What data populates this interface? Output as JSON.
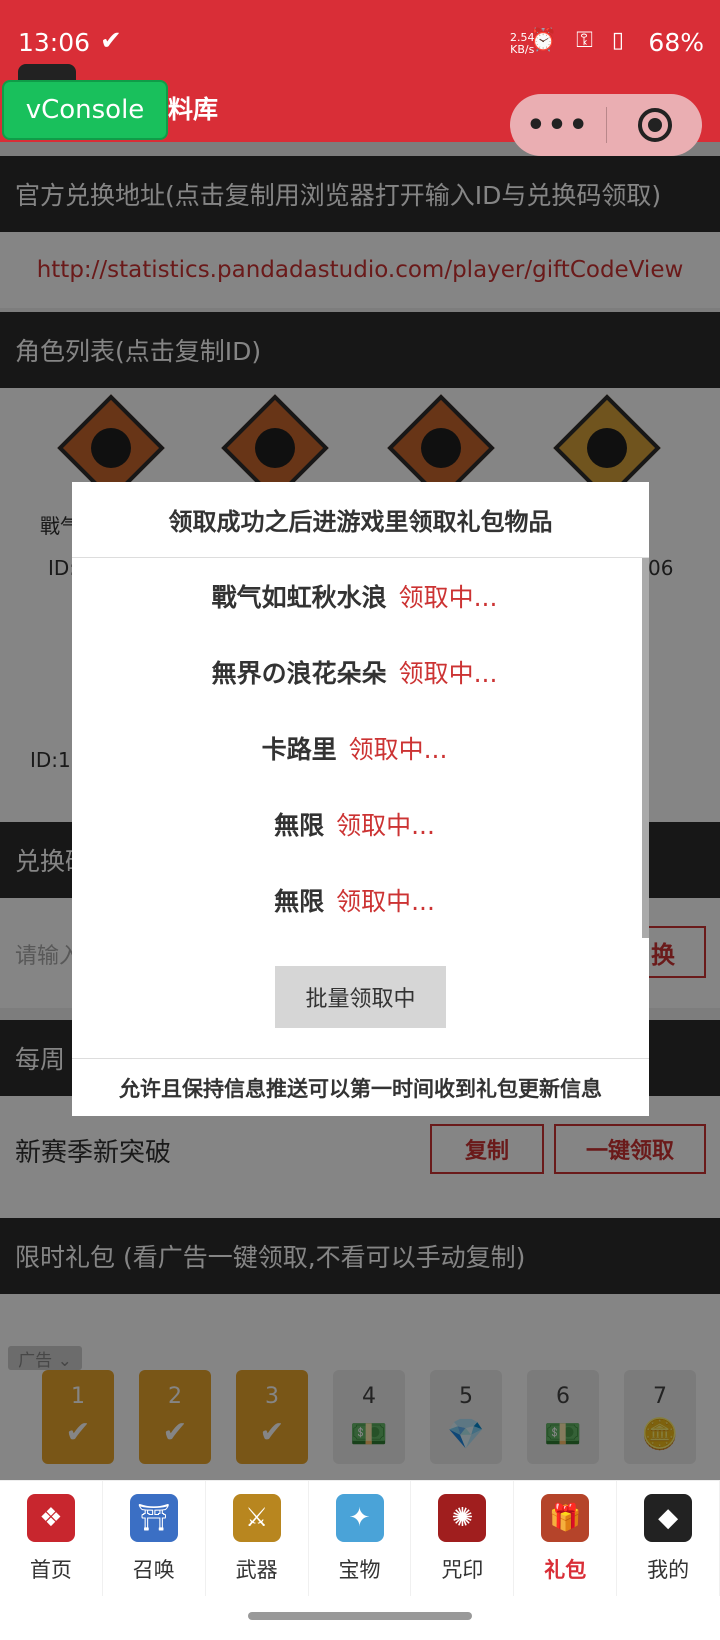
{
  "status_bar": {
    "time": "13:06",
    "battery": "68%",
    "speed_top": "2.54",
    "speed_unit": "KB/s"
  },
  "nav": {
    "title_suffix": "料库"
  },
  "vconsole_label": "vConsole",
  "capsule": {
    "more": "•••"
  },
  "sections": {
    "official": "官方兑换地址(点击复制用浏览器打开输入ID与兑换码领取)",
    "link": "http://statistics.pandadastudio.com/player/giftCodeView",
    "roles": "角色列表(点击复制ID)",
    "exchange_partial": "兑换码",
    "weekly_partial": "每周",
    "limited": "限时礼包 (看广告一键领取,不看可以手动复制)"
  },
  "roles": {
    "name_partial": "戰气",
    "id_partial_1": "ID:",
    "id_right": "06",
    "id_partial_2": "ID:10"
  },
  "exchange": {
    "placeholder_partial": "请输入",
    "button_partial": "换"
  },
  "weekly": {
    "text": "新赛季新突破",
    "copy_label": "复制",
    "claim_label": "一键领取"
  },
  "ad": {
    "tag": "广告 ⌄"
  },
  "days": [
    {
      "num": "1",
      "mark": "✔",
      "done": true
    },
    {
      "num": "2",
      "mark": "✔",
      "done": true
    },
    {
      "num": "3",
      "mark": "✔",
      "done": true
    },
    {
      "num": "4",
      "icon": "cash-icon",
      "done": false
    },
    {
      "num": "5",
      "icon": "gem-icon",
      "done": false
    },
    {
      "num": "6",
      "icon": "cash-icon",
      "done": false
    },
    {
      "num": "7",
      "icon": "coins-icon",
      "done": false
    }
  ],
  "modal": {
    "title": "领取成功之后进游戏里领取礼包物品",
    "items": [
      {
        "name": "戰气如虹秋水浪",
        "status": "领取中..."
      },
      {
        "name": "無界の浪花朵朵",
        "status": "领取中..."
      },
      {
        "name": "卡路里",
        "status": "领取中..."
      },
      {
        "name": "無限",
        "status": "领取中..."
      },
      {
        "name": "無限",
        "status": "领取中..."
      }
    ],
    "batch_button": "批量领取中",
    "footer": "允许且保持信息推送可以第一时间收到礼包更新信息"
  },
  "tabs": [
    {
      "label": "首页",
      "icon": "home-icon",
      "color": "#c8262e",
      "glyph": "❖"
    },
    {
      "label": "召唤",
      "icon": "summon-icon",
      "color": "#3b6fc4",
      "glyph": "⛩"
    },
    {
      "label": "武器",
      "icon": "weapon-icon",
      "color": "#b8861f",
      "glyph": "⚔"
    },
    {
      "label": "宝物",
      "icon": "treasure-icon",
      "color": "#4aa3d8",
      "glyph": "✦"
    },
    {
      "label": "咒印",
      "icon": "seal-icon",
      "color": "#a01e1e",
      "glyph": "✺"
    },
    {
      "label": "礼包",
      "icon": "gift-icon",
      "color": "#b5442a",
      "glyph": "🎁",
      "active": true
    },
    {
      "label": "我的",
      "icon": "profile-icon",
      "color": "#222222",
      "glyph": "◆"
    }
  ],
  "colors": {
    "brand_red": "#d92e37",
    "status_red": "#cc3333",
    "vconsole_green": "#19c05c",
    "day_done": "#e9a52c"
  }
}
